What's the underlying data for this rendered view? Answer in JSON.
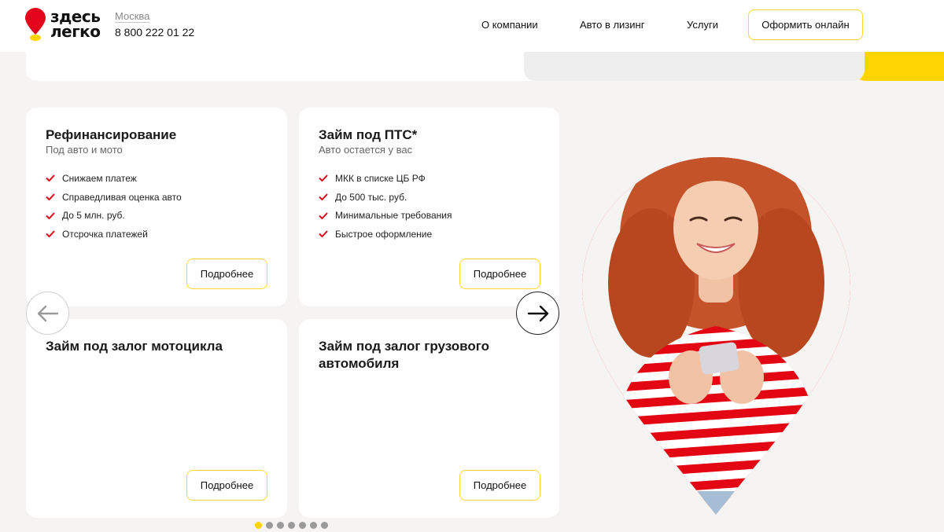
{
  "header": {
    "logo_line1": "здесь",
    "logo_line2": "легко",
    "city": "Москва",
    "phone": "8 800 222 01 22",
    "nav": [
      "О компании",
      "Авто в лизинг",
      "Услуги"
    ],
    "cta_label": "Оформить онлайн"
  },
  "cards": [
    {
      "title": "Рефинансирование",
      "subtitle": "Под авто и мото",
      "features": [
        "Снижаем платеж",
        "Справедливая оценка авто",
        "До 5 млн. руб.",
        "Отсрочка платежей"
      ],
      "button": "Подробнее"
    },
    {
      "title": "Займ под ПТС*",
      "subtitle": "Авто остается у вас",
      "features": [
        "МКК в списке ЦБ РФ",
        "До 500 тыс. руб.",
        "Минимальные требования",
        "Быстрое оформление"
      ],
      "button": "Подробнее"
    },
    {
      "title": "Займ под залог мотоцикла",
      "button": "Подробнее"
    },
    {
      "title": "Займ под залог грузового автомобиля",
      "button": "Подробнее"
    }
  ],
  "carousel": {
    "total_pages": 7,
    "active_page": 1
  },
  "icons": {
    "logo": "map-pin-logo-icon",
    "check": "check-icon",
    "prev": "arrow-left-icon",
    "next": "arrow-right-icon"
  },
  "colors": {
    "brand_red": "#e3051b",
    "brand_yellow": "#ffd400",
    "check_red": "#e3051b"
  }
}
